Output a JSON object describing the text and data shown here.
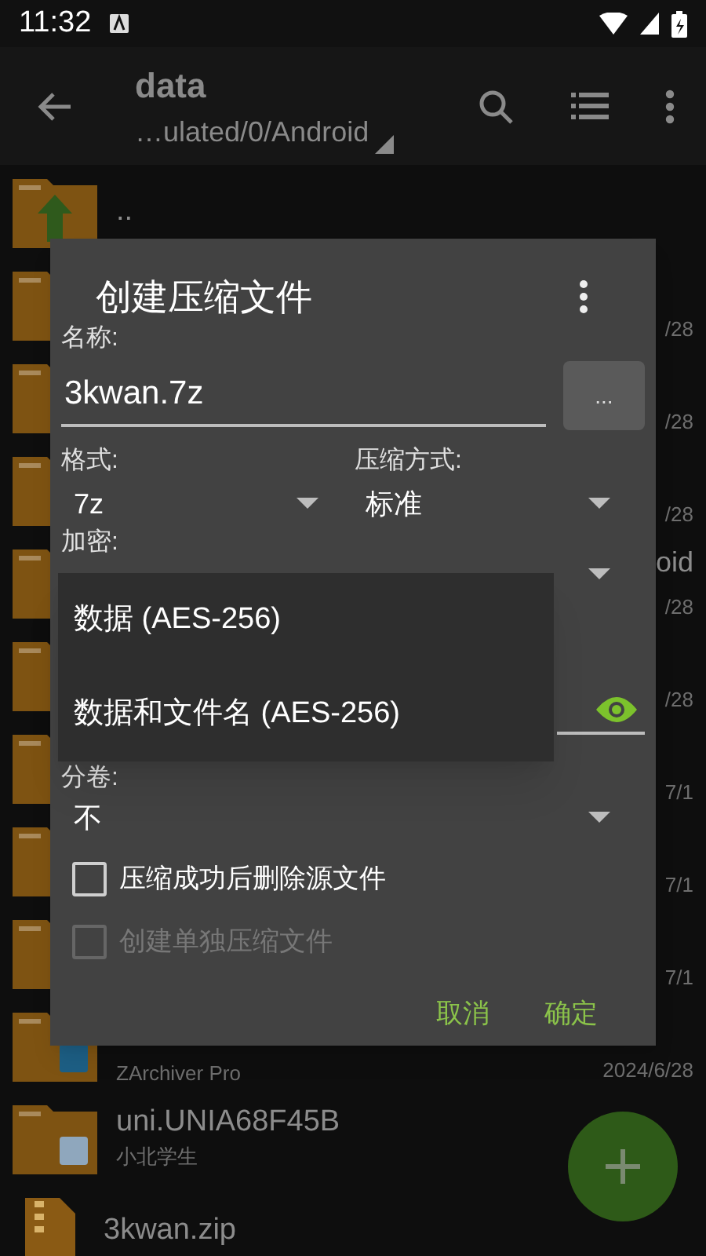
{
  "status_bar": {
    "time": "11:32"
  },
  "toolbar": {
    "title": "data",
    "path": "…ulated/0/Android"
  },
  "files": [
    {
      "kind": "up",
      "name": ".."
    },
    {
      "kind": "folder",
      "date": "/28"
    },
    {
      "kind": "folder",
      "date": "/28"
    },
    {
      "kind": "folder",
      "date": "/28"
    },
    {
      "kind": "folder",
      "name_tail": "oid",
      "date": "/28"
    },
    {
      "kind": "folder",
      "date": "/28"
    },
    {
      "kind": "folder",
      "date": "7/1"
    },
    {
      "kind": "folder",
      "date": "7/1"
    },
    {
      "kind": "folder",
      "date": "7/1"
    },
    {
      "kind": "app_folder",
      "subtitle": "ZArchiver Pro",
      "date": "2024/6/28"
    },
    {
      "kind": "app_folder",
      "name": "uni.UNIA68F45B",
      "subtitle": "小北学生"
    },
    {
      "kind": "zip",
      "name": "3kwan.zip"
    }
  ],
  "dialog": {
    "title": "创建压缩文件",
    "name_label": "名称:",
    "name_value": "3kwan.7z",
    "browse_button": "...",
    "format_label": "格式:",
    "format_value": "7z",
    "method_label": "压缩方式:",
    "method_value": "标准",
    "encryption_label": "加密:",
    "split_label": "分卷:",
    "split_value": "不",
    "checkboxes": [
      {
        "label": "压缩成功后删除源文件",
        "checked": false,
        "disabled": false
      },
      {
        "label": "创建单独压缩文件",
        "checked": false,
        "disabled": true
      }
    ],
    "buttons": [
      "取消",
      "确定"
    ]
  },
  "encryption_menu": [
    {
      "label": "数据 (AES-256)"
    },
    {
      "label": "数据和文件名 (AES-256)"
    }
  ]
}
